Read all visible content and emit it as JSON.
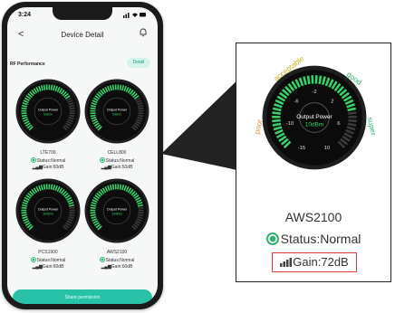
{
  "status_bar": {
    "time": "3:24",
    "signal": "..░ ◔ ▬"
  },
  "header": {
    "back_label": "<",
    "title": "Device Detail"
  },
  "section": {
    "title": "RF Performance",
    "detail_button": "Detail"
  },
  "gauge_labels": {
    "poor": "poor",
    "acceptable": "acceptable",
    "good": "good",
    "super": "super"
  },
  "gauge_scale": [
    "-15",
    "-10",
    "-6",
    "-2",
    "2",
    "6",
    "10"
  ],
  "bands": [
    {
      "name": "LTE700",
      "status": "Status:Normal",
      "gain": "Gain:60dB",
      "power_label": "Output Power",
      "power_value": "5dBm",
      "level": 0.7
    },
    {
      "name": "CELL800",
      "status": "Status:Normal",
      "gain": "Gain:50dB",
      "power_label": "Output Power",
      "power_value": "5dBm",
      "level": 0.7
    },
    {
      "name": "PCS1900",
      "status": "Status:Normal",
      "gain": "Gain:60dB",
      "power_label": "Output Power",
      "power_value": "10dBm",
      "level": 0.8
    },
    {
      "name": "AWS2100",
      "status": "Status:Normal",
      "gain": "Gain:60dB",
      "power_label": "Output Power",
      "power_value": "10dBm",
      "level": 0.8
    }
  ],
  "share_button": "Share permission",
  "zoom": {
    "name": "AWS2100",
    "status": "Status:Normal",
    "gain": "Gain:72dB",
    "power_label": "Output Power",
    "power_value": "10dBm",
    "level": 0.8,
    "scale": {
      "m15": "-15",
      "m10": "-10",
      "m6": "-6",
      "m2": "-2",
      "p2": "2",
      "p6": "6",
      "p10": "10"
    }
  },
  "colors": {
    "accent": "#27c2a8",
    "status_green": "#2fb36f",
    "gauge_green": "#39d16a",
    "highlight_red": "#e03a3a",
    "label_orange": "#e8923b",
    "label_yellow": "#c9b21a",
    "label_green": "#2fb36f"
  }
}
